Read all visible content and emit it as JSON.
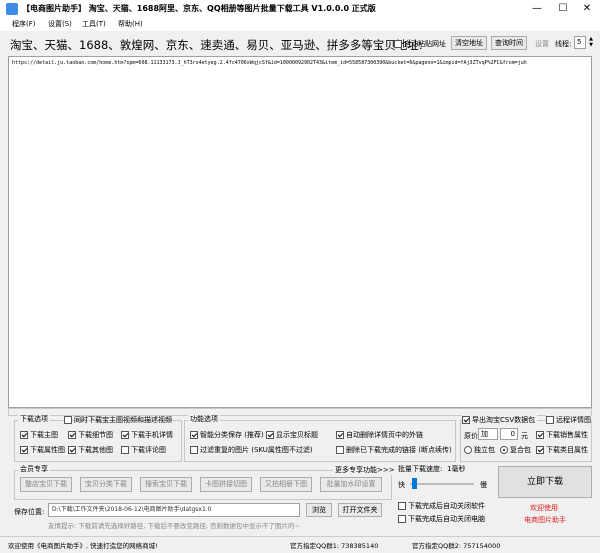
{
  "window": {
    "title": "【电商图片助手】 淘宝、天猫、1688阿里、京东、QQ相册等图片批量下载工具 V1.0.0.0 正式版",
    "min_glyph": "—",
    "max_glyph": "☐",
    "close_glyph": "✕"
  },
  "menu": [
    "程序(F)",
    "设置(S)",
    "工具(T)",
    "帮助(H)"
  ],
  "address": {
    "label": "淘宝、天猫、1688、敦煌网、京东、速卖通、易贝、亚马逊、拼多多等宝贝地址:",
    "auto_paste_label": "自动粘贴网址",
    "clear_btn": "清空地址",
    "query_btn": "查询时间",
    "settings_label": "设置",
    "threads_label": "线程:",
    "threads_value": "5"
  },
  "url_text": "https://detail.ju.taobao.com/home.htm?spm=608.11133173.J_hT3rs4etyeg.2.4fc4706xWqjcSf&id=10000092902T43&item_id=558587300390&bucket=6&pageno=1&impid=fAj3ZTvqP%2FC&from=juh",
  "download_options": {
    "group_label": "下载选项",
    "top_check": "同时下载宝主图视频和描述视频",
    "items": [
      {
        "label": "下载主图",
        "checked": true
      },
      {
        "label": "下载细节图",
        "checked": true
      },
      {
        "label": "下载手机详情",
        "checked": true
      },
      {
        "label": "下载属性图",
        "checked": true
      },
      {
        "label": "下载其他图",
        "checked": true
      },
      {
        "label": "下载评论图",
        "checked": false
      }
    ]
  },
  "function_options": {
    "group_label": "功能选项",
    "items": [
      {
        "label": "智能分类保存 (推荐)",
        "checked": true
      },
      {
        "label": "显示宝贝标题",
        "checked": true
      },
      {
        "label": "自动删除详情页中的外链",
        "checked": true
      },
      {
        "label": "过滤重复的图片 (SKU属性图不过滤)",
        "checked": false
      },
      {
        "label": "删除已下载完成的链接 (断点续传)",
        "checked": false
      }
    ]
  },
  "right_options": {
    "export_csv": "导出淘宝CSV数据包",
    "remote_detail": "远程详情图",
    "price_label": "原价",
    "price_op": "加",
    "price_value": "0",
    "price_unit": "元",
    "download_sales_attr": "下载销售属性",
    "radio_single": "独立包",
    "radio_combined": "复合包",
    "download_category_attr": "下载类目属性"
  },
  "member": {
    "label": "会员专享",
    "more_label": "更多专享功能>>>",
    "buttons": [
      "整店宝贝下载",
      "宝贝分类下载",
      "搜索宝贝下载",
      "卡图拼接切图",
      "又拍相册下图",
      "批量加水印设置"
    ]
  },
  "speed": {
    "label": "批量下载速度:",
    "value": "1毫秒",
    "fast": "快",
    "slow": "慢",
    "shutdown": "下载完成后自动关闭软件",
    "poweroff": "下载完成后自动关闭电脑"
  },
  "save": {
    "label": "保存位置:",
    "path": "D:\\下载\\工作文件夹\\2018-06-12\\电商图片助手\\datgsx1.0",
    "browse_btn": "浏览",
    "open_btn": "打开文件夹",
    "tip": "友情提示: 下载前请先选择好路径, 下载后不要改变路径, 否则数据包中显示不了图片的~"
  },
  "download_btn": "立即下载",
  "welcome": {
    "line1": "欢迎使用",
    "line2": "电商图片助手"
  },
  "status": {
    "left": "欢迎使用《电商图片助手》, 快速打造您的网络商城!",
    "qq1": "官方指定QQ群1: 738385140",
    "qq2": "官方指定QQ群2: 757154000"
  },
  "colors": {
    "accent_red": "#e02020",
    "download_btn_bg": "#e1e1e1"
  }
}
